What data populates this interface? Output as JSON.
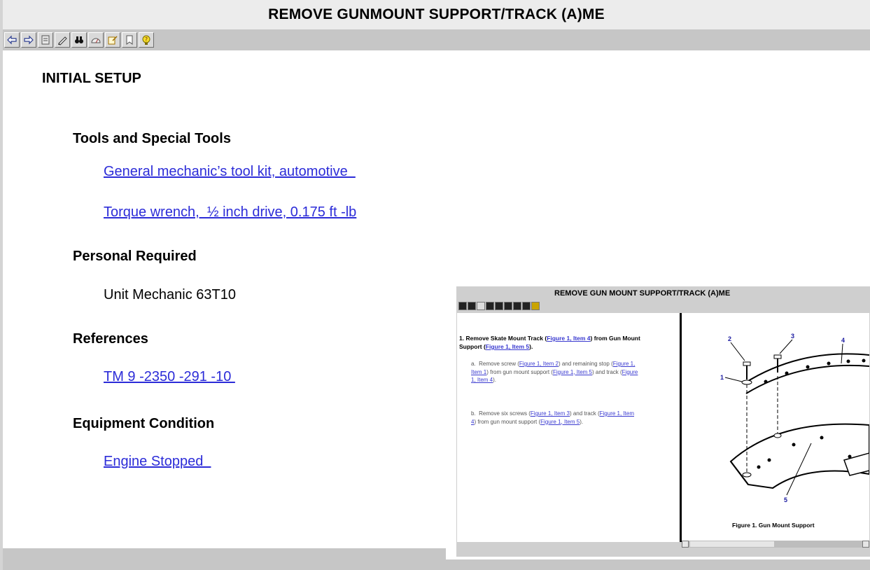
{
  "window": {
    "title": "REMOVE   GUNMOUNT  SUPPORT/TRACK (A)ME"
  },
  "toolbar": {
    "buttons": [
      {
        "icon": "back-arrow-icon"
      },
      {
        "icon": "forward-arrow-icon"
      },
      {
        "icon": "save-icon"
      },
      {
        "icon": "pencil-icon"
      },
      {
        "icon": "binoculars-icon"
      },
      {
        "icon": "gauge-icon"
      },
      {
        "icon": "edit-note-icon"
      },
      {
        "icon": "bookmark-icon"
      },
      {
        "icon": "help-bulb-icon"
      }
    ]
  },
  "main": {
    "heading": "INITIAL SETUP",
    "tools": {
      "heading": "Tools and Special Tools",
      "items": [
        "General mechanic’s tool kit, automotive  ",
        "Torque wrench,  ½ inch drive, 0.175 ft -lb"
      ]
    },
    "personnel": {
      "heading": "Personal Required",
      "item": "Unit Mechanic 63T10"
    },
    "references": {
      "heading": "References",
      "item": "TM 9 -2350 -291 -10 "
    },
    "equipment": {
      "heading": "Equipment Condition",
      "item": "Engine Stopped  "
    }
  },
  "preview": {
    "title": "REMOVE GUN MOUNT SUPPORT/TRACK (A)ME",
    "step1_prefix": "1.  Remove Skate Mount Track (",
    "step1_link1": "Figure 1, Item 4",
    "step1_mid": ") from Gun Mount Support (",
    "step1_link2": "Figure 1, Item 5",
    "step1_suffix": ").",
    "step_a": {
      "label": "a.",
      "t1": "Remove screw (",
      "l1": "Figure 1, Item 2",
      "t2": ") and remaining stop (",
      "l2": "Figure 1, Item 1",
      "t3": ") from gun mount support (",
      "l3": "Figure 1, Item 5",
      "t4": ") and track (",
      "l4": "Figure 1, Item 4",
      "t5": ")."
    },
    "step_b": {
      "label": "b.",
      "t1": "Remove six screws (",
      "l1": "Figure 1, Item 3",
      "t2": ") and track (",
      "l2": "Figure 1, Item 4",
      "t3": ") from gun mount support (",
      "l3": "Figure 1, Item 5",
      "t4": ")."
    },
    "figure_caption": "Figure 1. Gun Mount Support",
    "callouts": [
      "1",
      "2",
      "3",
      "4",
      "5"
    ]
  }
}
